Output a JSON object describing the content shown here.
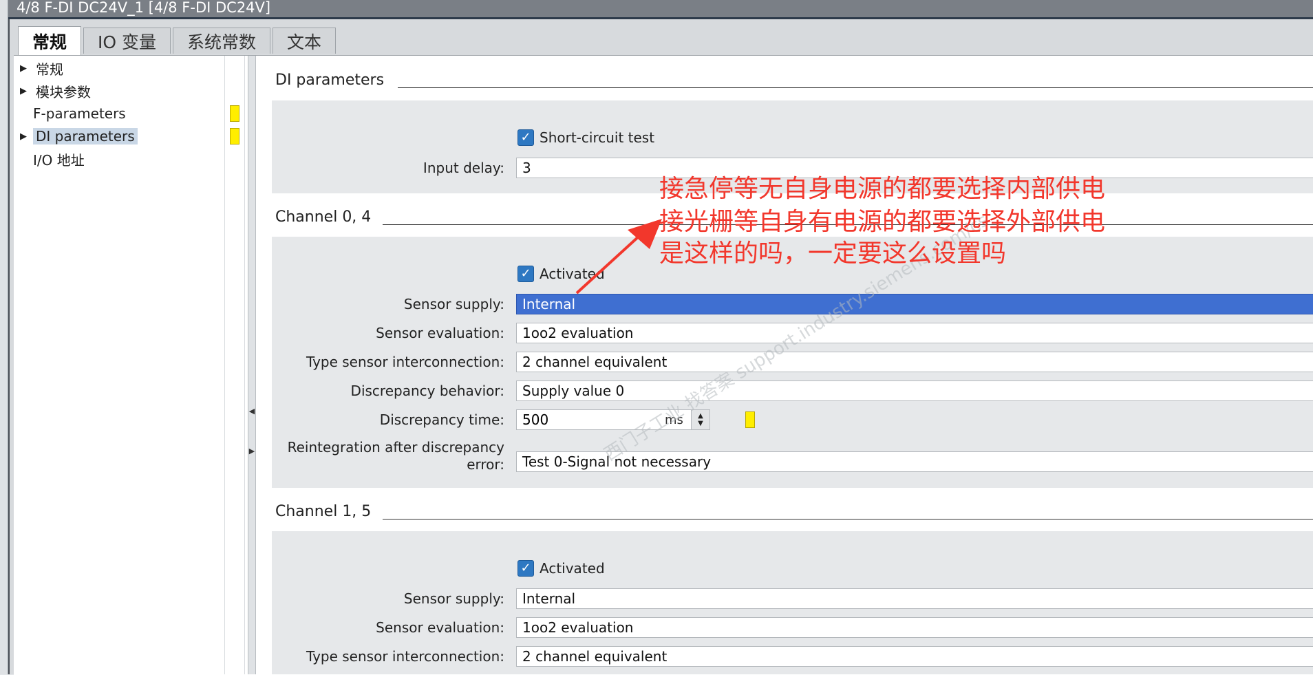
{
  "window": {
    "title": "4/8 F-DI DC24V_1 [4/8 F-DI DC24V]"
  },
  "tabs": [
    {
      "label": "常规",
      "active": true
    },
    {
      "label": "IO 变量",
      "active": false
    },
    {
      "label": "系统常数",
      "active": false
    },
    {
      "label": "文本",
      "active": false
    }
  ],
  "nav": [
    {
      "label": "常规",
      "expandable": true,
      "selected": false,
      "flag": false
    },
    {
      "label": "模块参数",
      "expandable": true,
      "selected": false,
      "flag": false
    },
    {
      "label": "F-parameters",
      "expandable": false,
      "selected": false,
      "flag": true
    },
    {
      "label": "DI parameters",
      "expandable": true,
      "selected": true,
      "flag": true
    },
    {
      "label": "I/O 地址",
      "expandable": false,
      "selected": false,
      "flag": false
    }
  ],
  "di": {
    "title": "DI parameters",
    "short_circuit_label": "Short-circuit test",
    "short_circuit_checked": true,
    "input_delay_label": "Input delay:",
    "input_delay_value": "3"
  },
  "ch04": {
    "title": "Channel 0, 4",
    "activated_label": "Activated",
    "activated_checked": true,
    "sensor_supply_label": "Sensor supply:",
    "sensor_supply_value": "Internal",
    "sensor_eval_label": "Sensor evaluation:",
    "sensor_eval_value": "1oo2 evaluation",
    "type_label": "Type sensor interconnection:",
    "type_value": "2 channel equivalent",
    "disc_behavior_label": "Discrepancy behavior:",
    "disc_behavior_value": "Supply value 0",
    "disc_time_label": "Discrepancy time:",
    "disc_time_value": "500",
    "disc_time_unit": "ms",
    "reint_label_1": "Reintegration after discrepancy",
    "reint_label_2": "error:",
    "reint_value": "Test 0-Signal not necessary"
  },
  "ch15": {
    "title": "Channel 1, 5",
    "activated_label": "Activated",
    "activated_checked": true,
    "sensor_supply_label": "Sensor supply:",
    "sensor_supply_value": "Internal",
    "sensor_eval_label": "Sensor evaluation:",
    "sensor_eval_value": "1oo2 evaluation",
    "type_label": "Type sensor interconnection:",
    "type_value": "2 channel equivalent"
  },
  "annotation": {
    "line1": "接急停等无自身电源的都要选择内部供电",
    "line2": "接光栅等自身有电源的都要选择外部供电",
    "line3": "是这样的吗，一定要这么设置吗",
    "color": "#f2372c"
  },
  "watermark": {
    "text": "西门子工业 找答案 support.industry.siemens.com/cs"
  },
  "colors": {
    "selection": "#3f6fd1",
    "checkbox": "#2e78c2",
    "flag": "#ffee00"
  }
}
